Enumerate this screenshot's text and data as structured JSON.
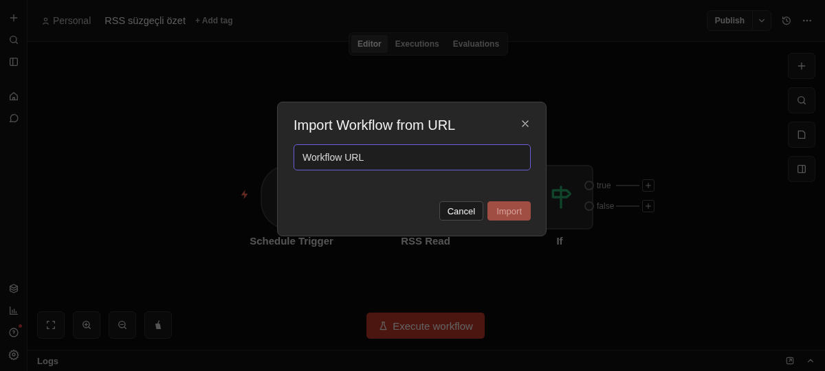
{
  "header": {
    "project": "Personal",
    "workflow_name": "RSS süzgeçli özet",
    "add_tag": "+ Add tag",
    "publish": "Publish"
  },
  "view_tabs": [
    {
      "label": "Editor",
      "selected": true
    },
    {
      "label": "Executions",
      "selected": false
    },
    {
      "label": "Evaluations",
      "selected": false
    }
  ],
  "nodes": [
    {
      "name": "Schedule Trigger",
      "kind": "trigger"
    },
    {
      "name": "RSS Read",
      "kind": "action"
    },
    {
      "name": "If",
      "kind": "if",
      "outputs": [
        "true",
        "false"
      ]
    }
  ],
  "execute_button": "Execute workflow",
  "logs": {
    "title": "Logs"
  },
  "dialog": {
    "title": "Import Workflow from URL",
    "url_field": {
      "placeholder": "Workflow URL"
    },
    "buttons": [
      {
        "label": "Cancel",
        "kind": "secondary",
        "disabled": false
      },
      {
        "label": "Import",
        "kind": "primary",
        "disabled": true
      }
    ]
  }
}
